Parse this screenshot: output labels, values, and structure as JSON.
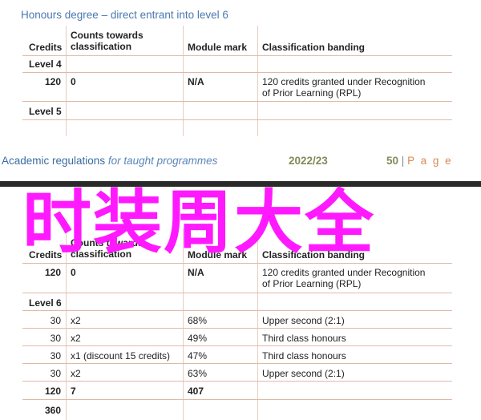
{
  "page1": {
    "heading": "Honours degree – direct entrant into level 6",
    "headers": {
      "credits": "Credits",
      "counts_l1": "Counts towards",
      "counts_l2": "classification",
      "module_mark": "Module mark",
      "banding": "Classification banding"
    },
    "level4": "Level 4",
    "row1": {
      "credits": "120",
      "counts": "0",
      "mark": "N/A",
      "banding_l1": "120 credits granted under Recognition",
      "banding_l2": "of Prior Learning (RPL)"
    },
    "level5": "Level 5"
  },
  "footer": {
    "title": "Academic regulations",
    "subtitle": "for taught programmes",
    "year": "2022/23",
    "page_number": "50",
    "separator": "|",
    "page_word": "P a g e"
  },
  "overlay_text": "时装周大全",
  "page2": {
    "headers": {
      "credits": "Credits",
      "counts_l1": "Counts towards",
      "counts_l2": "classification",
      "module_mark": "Module mark",
      "banding": "Classification banding"
    },
    "row_rpl": {
      "credits": "120",
      "counts": "0",
      "mark": "N/A",
      "banding_l1": "120 credits granted under Recognition",
      "banding_l2": "of Prior Learning (RPL)"
    },
    "level6": "Level 6",
    "rows": [
      {
        "credits": "30",
        "counts": "x2",
        "mark": "68%",
        "banding": "Upper second (2:1)"
      },
      {
        "credits": "30",
        "counts": "x2",
        "mark": "49%",
        "banding": "Third class honours"
      },
      {
        "credits": "30",
        "counts": "x1 (discount 15 credits)",
        "mark": "47%",
        "banding": "Third class honours"
      },
      {
        "credits": "30",
        "counts": "x2",
        "mark": "63%",
        "banding": "Upper second (2:1)"
      }
    ],
    "total": {
      "credits": "120",
      "counts": "7",
      "mark": "407"
    },
    "grand_total": {
      "credits": "360"
    }
  },
  "colors": {
    "heading_blue": "#4a78b0",
    "overlay_magenta": "#ff19ff",
    "rule": "#e0b9a6",
    "footer_olive": "#7f8b59",
    "page_orange": "#d88a55"
  }
}
